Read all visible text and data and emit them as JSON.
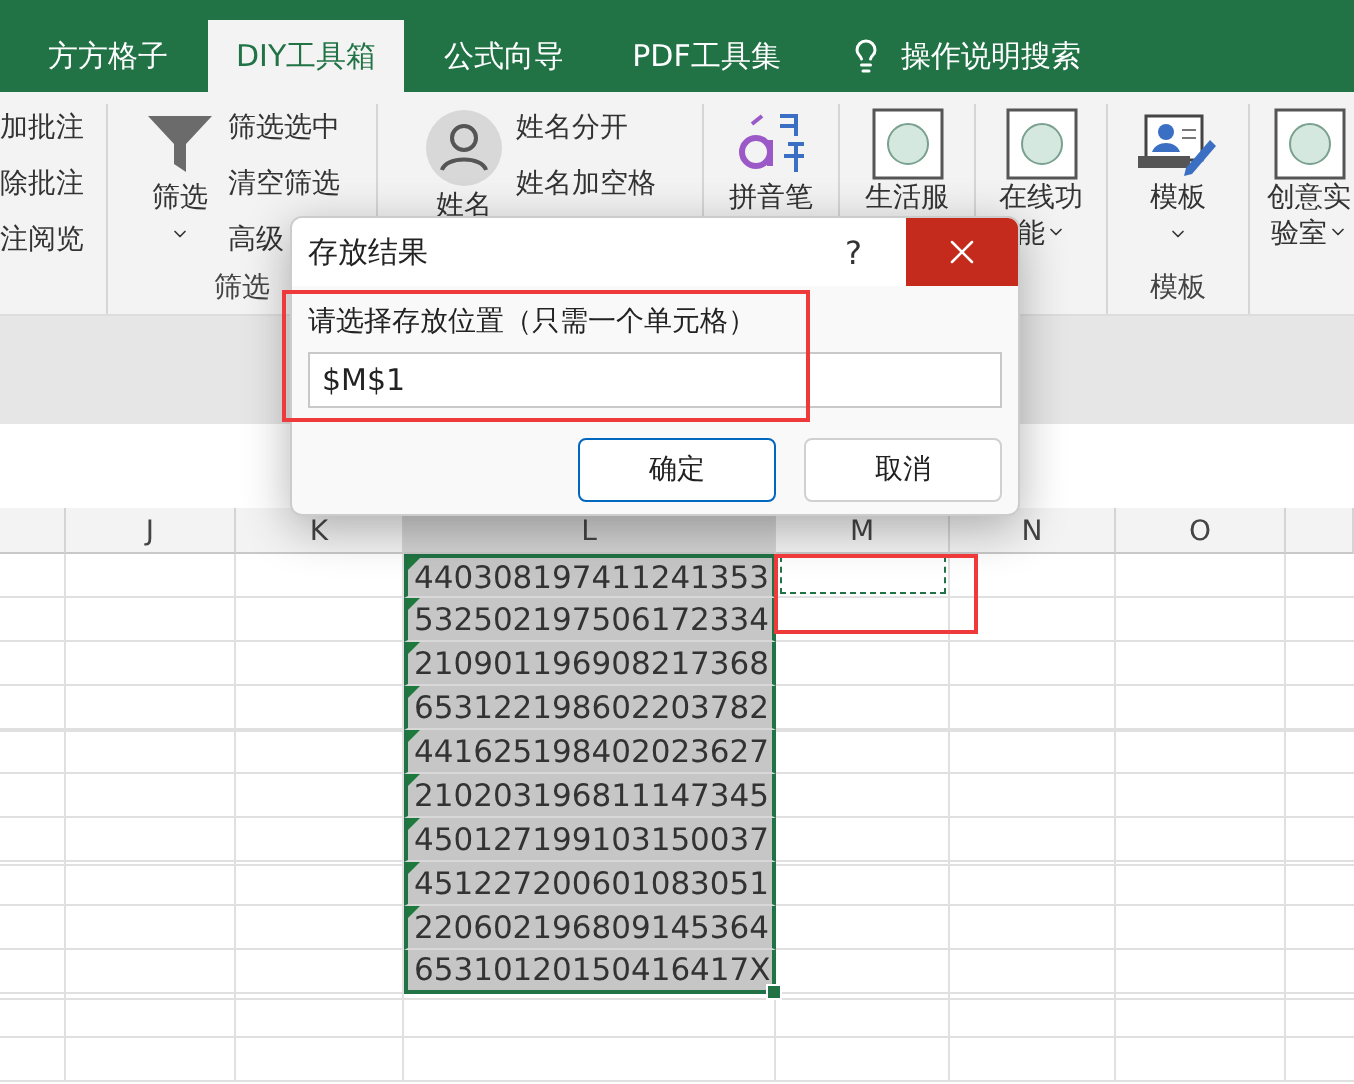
{
  "tabs": [
    {
      "label": "方方格子",
      "selected": false
    },
    {
      "label": "DIY工具箱",
      "selected": true
    },
    {
      "label": "公式向导",
      "selected": false
    },
    {
      "label": "PDF工具集",
      "selected": false
    }
  ],
  "search": {
    "label": "操作说明搜索"
  },
  "ribbon": {
    "groups": [
      {
        "items": [
          {
            "kind": "small",
            "labels": [
              "加批注",
              "除批注",
              "注阅览"
            ]
          }
        ]
      },
      {
        "label": "筛选",
        "items": [
          {
            "kind": "large",
            "lines": [
              "筛选"
            ],
            "dropdown": true
          },
          {
            "kind": "small",
            "labels": [
              "筛选选中",
              "清空筛选",
              "高级"
            ]
          }
        ]
      },
      {
        "items": [
          {
            "kind": "large",
            "lines": [
              "姓名"
            ]
          },
          {
            "kind": "small",
            "labels": [
              "姓名分开",
              "姓名加空格"
            ]
          }
        ]
      },
      {
        "items": [
          {
            "kind": "large",
            "lines": [
              "拼音笔"
            ]
          }
        ]
      },
      {
        "items": [
          {
            "kind": "large",
            "lines": [
              "生活服"
            ]
          }
        ]
      },
      {
        "items": [
          {
            "kind": "large",
            "lines": [
              "在线功",
              "能"
            ],
            "dropdown": true
          }
        ]
      },
      {
        "label": "模板",
        "items": [
          {
            "kind": "large",
            "lines": [
              "模板"
            ],
            "dropdown": true
          }
        ]
      },
      {
        "items": [
          {
            "kind": "large",
            "lines": [
              "创意实",
              "验室"
            ],
            "dropdown": true
          }
        ]
      }
    ]
  },
  "sheet": {
    "columns": [
      {
        "label": "J",
        "selected": false
      },
      {
        "label": "K",
        "selected": false
      },
      {
        "label": "L",
        "selected": true
      },
      {
        "label": "M",
        "selected": false
      },
      {
        "label": "N",
        "selected": false
      },
      {
        "label": "O",
        "selected": false
      }
    ],
    "cells": [
      {
        "value": "440308197411241353",
        "flagged": true
      },
      {
        "value": "532502197506172334",
        "flagged": true
      },
      {
        "value": "210901196908217368",
        "flagged": true
      },
      {
        "value": "653122198602203782",
        "flagged": true
      },
      {
        "value": "441625198402023627",
        "flagged": true
      },
      {
        "value": "210203196811147345",
        "flagged": true
      },
      {
        "value": "450127199103150037",
        "flagged": true
      },
      {
        "value": "451227200601083051",
        "flagged": true
      },
      {
        "value": "220602196809145364",
        "flagged": true
      },
      {
        "value": "65310120150416417X",
        "flagged": false
      }
    ]
  },
  "dialog": {
    "title": "存放结果",
    "help": "?",
    "label": "请选择存放位置（只需一个单元格）",
    "value": "$M$1",
    "buttons": [
      {
        "label": "确定",
        "default": true
      },
      {
        "label": "取消",
        "default": false
      }
    ]
  }
}
